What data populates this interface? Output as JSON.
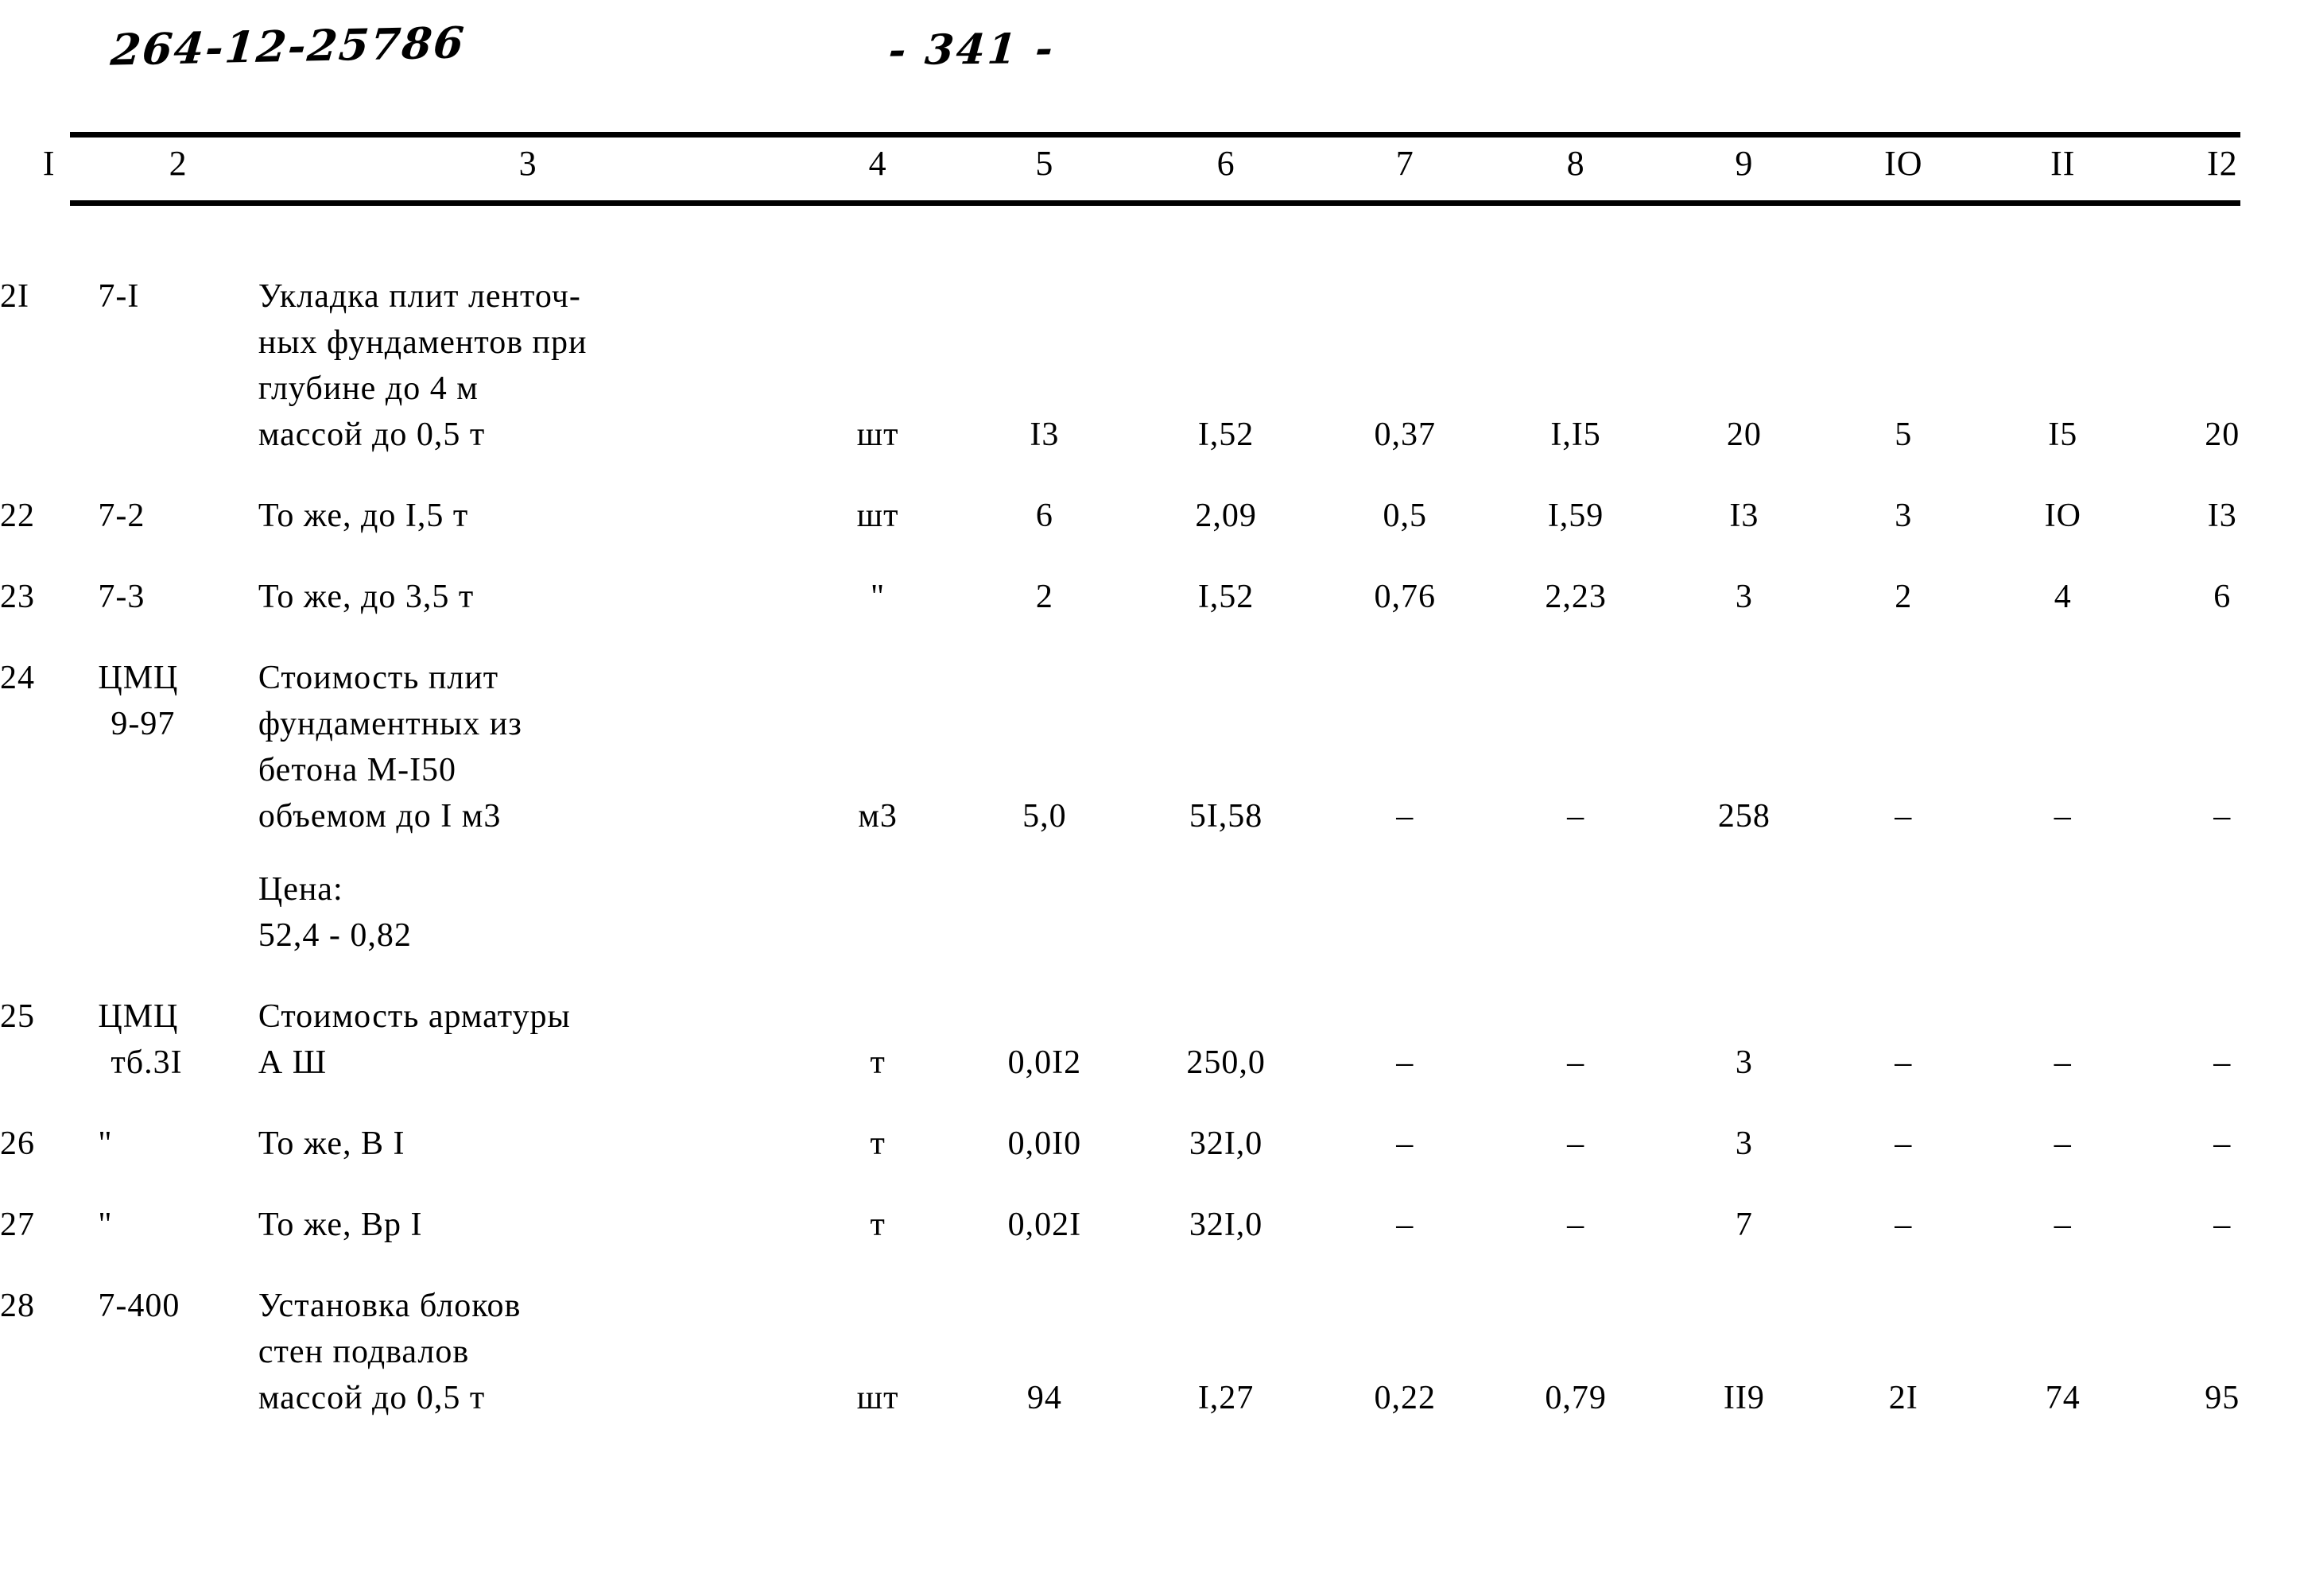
{
  "annotations": {
    "stamp_code": "264-12-25786",
    "page_number": "- 341 -"
  },
  "table": {
    "column_headers": [
      "I",
      "2",
      "3",
      "4",
      "5",
      "6",
      "7",
      "8",
      "9",
      "IO",
      "II",
      "I2"
    ],
    "rows": [
      {
        "idx": "2I",
        "code": "7-I",
        "desc_lines": [
          "Укладка плит ленточ-",
          "ных фундаментов при",
          "глубине до 4 м",
          "массой до 0,5 т"
        ],
        "unit": "шт",
        "c5": "I3",
        "c6": "I,52",
        "c7": "0,37",
        "c8": "I,I5",
        "c9": "20",
        "c10": "5",
        "c11": "I5",
        "c12": "20"
      },
      {
        "idx": "22",
        "code": "7-2",
        "desc_lines": [
          "То же, до I,5 т"
        ],
        "unit": "шт",
        "c5": "6",
        "c6": "2,09",
        "c7": "0,5",
        "c8": "I,59",
        "c9": "I3",
        "c10": "3",
        "c11": "IO",
        "c12": "I3"
      },
      {
        "idx": "23",
        "code": "7-3",
        "desc_lines": [
          "То же, до 3,5 т"
        ],
        "unit": "\"",
        "c5": "2",
        "c6": "I,52",
        "c7": "0,76",
        "c8": "2,23",
        "c9": "3",
        "c10": "2",
        "c11": "4",
        "c12": "6"
      },
      {
        "idx": "24",
        "code_lines": [
          "ЦМЦ",
          "9-97"
        ],
        "desc_lines": [
          "Стоимость плит",
          "фундаментных из",
          "бетона М-I50",
          "объемом до I м3"
        ],
        "desc_extra": [
          "Цена:",
          "52,4 - 0,82"
        ],
        "unit": "м3",
        "c5": "5,0",
        "c6": "5I,58",
        "c7": "–",
        "c8": "–",
        "c9": "258",
        "c10": "–",
        "c11": "–",
        "c12": "–"
      },
      {
        "idx": "25",
        "code_lines": [
          "ЦМЦ",
          "тб.3I"
        ],
        "desc_lines": [
          "Стоимость арматуры",
          "А Ш"
        ],
        "unit": "т",
        "c5": "0,0I2",
        "c6": "250,0",
        "c7": "–",
        "c8": "–",
        "c9": "3",
        "c10": "–",
        "c11": "–",
        "c12": "–"
      },
      {
        "idx": "26",
        "code": "\"",
        "desc_lines": [
          "То же, В I"
        ],
        "unit": "т",
        "c5": "0,0I0",
        "c6": "32I,0",
        "c7": "–",
        "c8": "–",
        "c9": "3",
        "c10": "–",
        "c11": "–",
        "c12": "–"
      },
      {
        "idx": "27",
        "code": "\"",
        "desc_lines": [
          "То же, Вр I"
        ],
        "unit": "т",
        "c5": "0,02I",
        "c6": "32I,0",
        "c7": "–",
        "c8": "–",
        "c9": "7",
        "c10": "–",
        "c11": "–",
        "c12": "–"
      },
      {
        "idx": "28",
        "code": "7-400",
        "desc_lines": [
          "Установка блоков",
          "стен подвалов",
          "массой до 0,5 т"
        ],
        "unit": "шт",
        "c5": "94",
        "c6": "I,27",
        "c7": "0,22",
        "c8": "0,79",
        "c9": "II9",
        "c10": "2I",
        "c11": "74",
        "c12": "95"
      }
    ]
  }
}
